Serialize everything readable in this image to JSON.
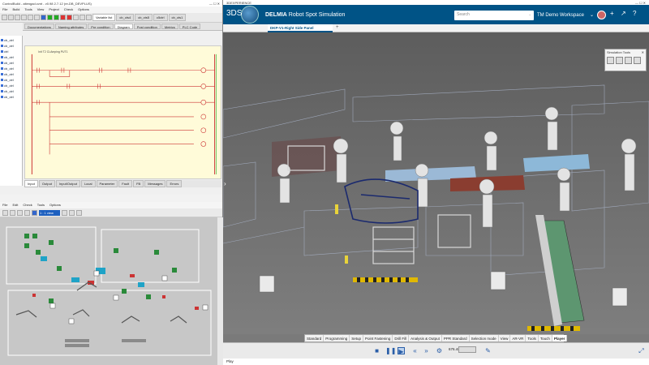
{
  "plc_window": {
    "title": "ControlBuild - altengad.cvnt - v0.98 2.7.12 (re-DB_DEVPLUS)",
    "menu": [
      "File",
      "Build",
      "Tools",
      "View",
      "Project",
      "Check",
      "Options"
    ],
    "tabs": [
      "Variable list",
      "cb_cts4",
      "cb_cts5",
      "c5ctrl",
      "cb_cts1"
    ],
    "subtabs": [
      "Documentations",
      "Naming attributes",
      "Pre condition",
      "Diagram",
      "Post condition",
      "Metrics",
      "PLC Code"
    ],
    "tree_items": [
      "cb_ctrl",
      "cb_ctrl",
      "ctrl",
      "cb_ctrl",
      "cb_ctrl",
      "cb_ctrl",
      "cb_ctrl",
      "cb_ctrl",
      "cb_ctrl",
      "cb_ctrl",
      "cb_ctrl"
    ],
    "bottom_tabs": [
      "Input",
      "Output",
      "Input/Output",
      "Local",
      "Parameter",
      "Fault",
      "FB",
      "Messages",
      "Errors"
    ],
    "ladder_title": "Init T2 CLAmping PUT1"
  },
  "sim2d_window": {
    "title": "",
    "menu": [
      "File",
      "Edit",
      "Check",
      "Tools",
      "Options"
    ],
    "zoom_value": "1 : 1 view"
  },
  "dx": {
    "os_title": "3DEXPERIENCE",
    "brand": "3DS",
    "app_title_brand": "DELMIA",
    "app_title_rest": "Robot Spot Simulation",
    "search_placeholder": "Search",
    "workspace": "TM Demo Workspace",
    "doc_tab": "DKP-V1-Right Side Panel",
    "sim_tools_title": "Simulation Tools",
    "action_tabs": [
      "Standard",
      "Programming",
      "Setup",
      "Point Fastening",
      "Drill Fill",
      "Analysis & Output",
      "PPR Standard",
      "Selection mode",
      "View",
      "AR-VR",
      "Tools",
      "Touch",
      "Player"
    ],
    "active_action_tab": "Player",
    "rate": "676.4s",
    "status": "Play"
  },
  "colors": {
    "header_blue": "#005386",
    "ladder_bg": "#fffbd9",
    "play_blue": "#2a5ea8"
  }
}
